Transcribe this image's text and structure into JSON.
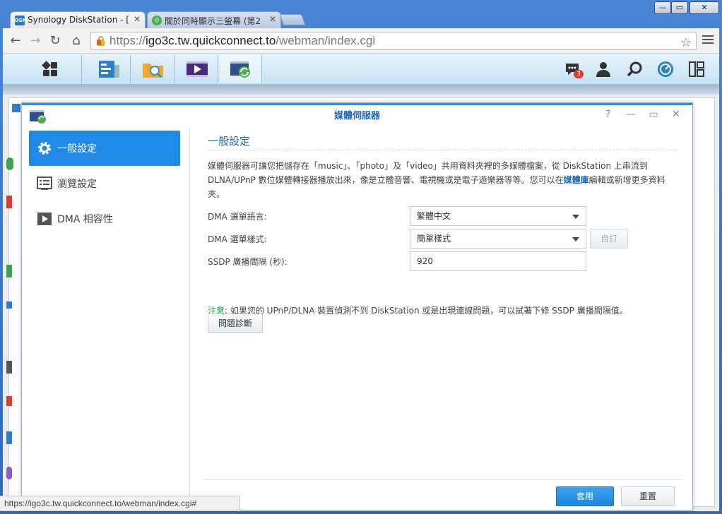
{
  "browser": {
    "tabs": [
      {
        "title": "Synology DiskStation - [",
        "favicon_text": "DSM",
        "active": true
      },
      {
        "title": "關於同時顯示三螢幕 (第2",
        "active": false
      }
    ],
    "url_prefix": "https://",
    "url_host": "igo3c.tw.quickconnect.to",
    "url_path": "/webman/index.cgi",
    "status_url": "https://igo3c.tw.quickconnect.to/webman/index.cgi#"
  },
  "dsm": {
    "notification_count": "3",
    "icons": [
      "main-menu-icon",
      "control-panel-icon",
      "file-station-icon",
      "video-station-icon",
      "media-server-icon",
      "notifications-icon",
      "user-icon",
      "search-icon",
      "widgets-icon",
      "desktop-icon"
    ]
  },
  "window": {
    "title": "媒體伺服器",
    "help": "?"
  },
  "sidebar": {
    "items": [
      {
        "label": "一般設定",
        "icon": "gear-icon"
      },
      {
        "label": "瀏覽設定",
        "icon": "list-icon"
      },
      {
        "label": "DMA 相容性",
        "icon": "play-icon"
      }
    ]
  },
  "general": {
    "section_title": "一般設定",
    "description_before": "媒體伺服器可讓您把儲存在「music」、「photo」及「video」共用資料夾裡的多媒體檔案，從 DiskStation 上串流到 DLNA/UPnP 數位媒體轉接器播放出來，像是立體音響、電視機或是電子遊樂器等等。您可以在",
    "description_link": "媒體庫",
    "description_after": "編輯或新增更多資料夾。",
    "fields": {
      "language": {
        "label": "DMA 選單語言:",
        "value": "繁體中文"
      },
      "style": {
        "label": "DMA 選單樣式:",
        "value": "簡單樣式",
        "customize_label": "自訂"
      },
      "ssdp": {
        "label": "SSDP 廣播間隔 (秒):",
        "value": "920"
      }
    },
    "note_tag": "注意:",
    "note_text": " 如果您的 UPnP/DLNA 裝置偵測不到 DiskStation 或是出現連線問題，可以試著下修 SSDP 廣播間隔值。",
    "diagnose_label": "問題診斷"
  },
  "footer": {
    "apply_label": "套用",
    "reset_label": "重置"
  }
}
